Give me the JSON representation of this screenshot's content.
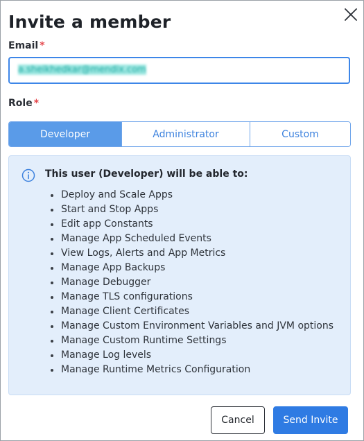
{
  "dialog": {
    "title": "Invite a member",
    "close_icon": "close-icon"
  },
  "email": {
    "label": "Email",
    "required_mark": "*",
    "value": "a.sheikhedkar@mendix.com"
  },
  "role": {
    "label": "Role",
    "required_mark": "*",
    "options": [
      {
        "label": "Developer",
        "selected": true
      },
      {
        "label": "Administrator",
        "selected": false
      },
      {
        "label": "Custom",
        "selected": false
      }
    ]
  },
  "info": {
    "icon": "info-icon",
    "heading": "This user (Developer) will be able to:",
    "permissions": [
      "Deploy and Scale Apps",
      "Start and Stop Apps",
      "Edit app Constants",
      "Manage App Scheduled Events",
      "View Logs, Alerts and App Metrics",
      "Manage App Backups",
      "Manage Debugger",
      "Manage TLS configurations",
      "Manage Client Certificates",
      "Manage Custom Environment Variables and JVM options",
      "Manage Custom Runtime Settings",
      "Manage Log levels",
      "Manage Runtime Metrics Configuration"
    ]
  },
  "actions": {
    "cancel_label": "Cancel",
    "send_label": "Send Invite"
  },
  "colors": {
    "accent": "#2f7be3",
    "selected_segment": "#5a9be8",
    "info_background": "#e3eefb",
    "required": "#e5484d"
  }
}
